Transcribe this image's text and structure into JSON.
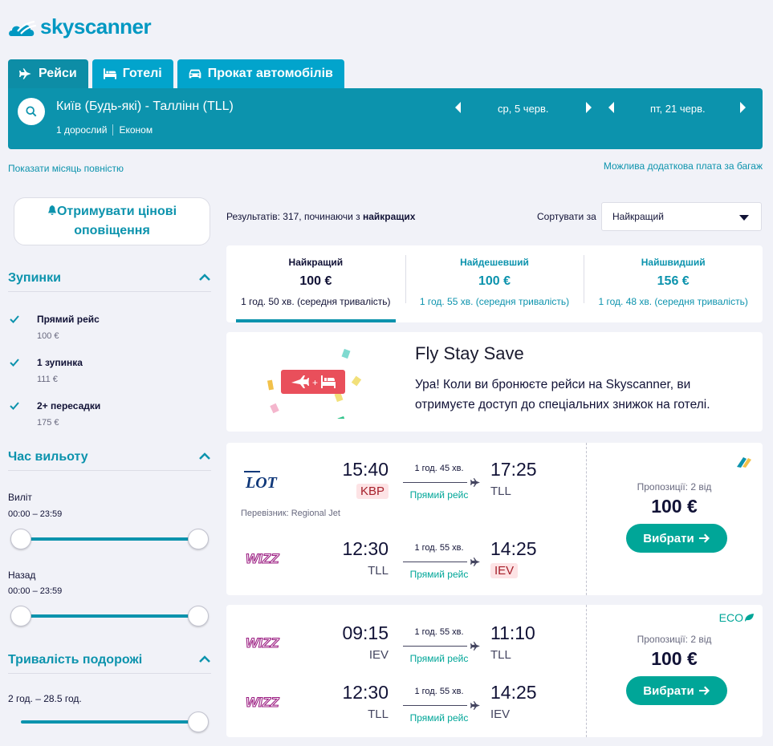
{
  "brand": {
    "name": "skyscanner"
  },
  "tabs": [
    {
      "label": "Рейси",
      "icon": "plane-icon"
    },
    {
      "label": "Готелі",
      "icon": "bed-icon"
    },
    {
      "label": "Прокат автомобілів",
      "icon": "car-icon"
    }
  ],
  "search": {
    "route": "Київ (Будь-які) - Таллінн (TLL)",
    "travellers": "1 дорослий",
    "cabin": "Економ",
    "depart_date": "ср, 5 черв.",
    "return_date": "пт, 21 черв."
  },
  "links": {
    "show_month": "Показати місяць повністю",
    "baggage_fees": "Можлива додаткова плата за багаж"
  },
  "sidebar": {
    "alerts_button": "Отримувати цінові оповіщення",
    "stops": {
      "title": "Зупинки",
      "options": [
        {
          "label": "Прямий рейс",
          "price": "100 €"
        },
        {
          "label": "1 зупинка",
          "price": "111 €"
        },
        {
          "label": "2+ пересадки",
          "price": "175 €"
        }
      ]
    },
    "times": {
      "title": "Час вильоту",
      "outbound_label": "Виліт",
      "outbound_range": "00:00 – 23:59",
      "return_label": "Назад",
      "return_range": "00:00 – 23:59"
    },
    "duration": {
      "title": "Тривалість подорожі",
      "range": "2 год. – 28.5 год."
    }
  },
  "results": {
    "count_prefix": "Результатів: 317, починаючи з ",
    "count_bold": "найкращих",
    "sort_label": "Сортувати за",
    "sort_value": "Найкращий"
  },
  "summary": [
    {
      "title": "Найкращий",
      "price": "100 €",
      "duration": "1 год. 50 хв. (середня тривалість)"
    },
    {
      "title": "Найдешевший",
      "price": "100 €",
      "duration": "1 год. 55 хв. (середня тривалість)"
    },
    {
      "title": "Найшвидший",
      "price": "156 €",
      "duration": "1 год. 48 хв. (середня тривалість)"
    }
  ],
  "promo": {
    "title": "Fly Stay Save",
    "text": "Ура! Коли ви бронюєте рейси на Skyscanner, ви отримуєте доступ до спеціальних знижок на готелі."
  },
  "itineraries": [
    {
      "legs": [
        {
          "airline": "LOT",
          "dep_time": "15:40",
          "dep_airport": "KBP",
          "duration": "1 год. 45 хв.",
          "stops": "Прямий рейс",
          "arr_time": "17:25",
          "arr_airport": "TLL"
        },
        {
          "airline": "WIZZ",
          "dep_time": "12:30",
          "dep_airport": "TLL",
          "duration": "1 год. 55 хв.",
          "stops": "Прямий рейс",
          "arr_time": "14:25",
          "arr_airport": "IEV"
        }
      ],
      "operator": "Перевізник: Regional Jet",
      "offers": "Пропозиції: 2 від",
      "price": "100 €",
      "select_label": "Вибрати"
    },
    {
      "badge": "ECO",
      "legs": [
        {
          "airline": "WIZZ",
          "dep_time": "09:15",
          "dep_airport": "IEV",
          "duration": "1 год. 55 хв.",
          "stops": "Прямий рейс",
          "arr_time": "11:10",
          "arr_airport": "TLL"
        },
        {
          "airline": "WIZZ",
          "dep_time": "12:30",
          "dep_airport": "TLL",
          "duration": "1 год. 55 хв.",
          "stops": "Прямий рейс",
          "arr_time": "14:25",
          "arr_airport": "IEV"
        }
      ],
      "offers": "Пропозиції: 2 від",
      "price": "100 €",
      "select_label": "Вибрати"
    }
  ],
  "colors": {
    "teal": "#0c93ad",
    "tab": "#02a4cc",
    "green": "#00a698",
    "warn_bg": "#fde3e5"
  }
}
